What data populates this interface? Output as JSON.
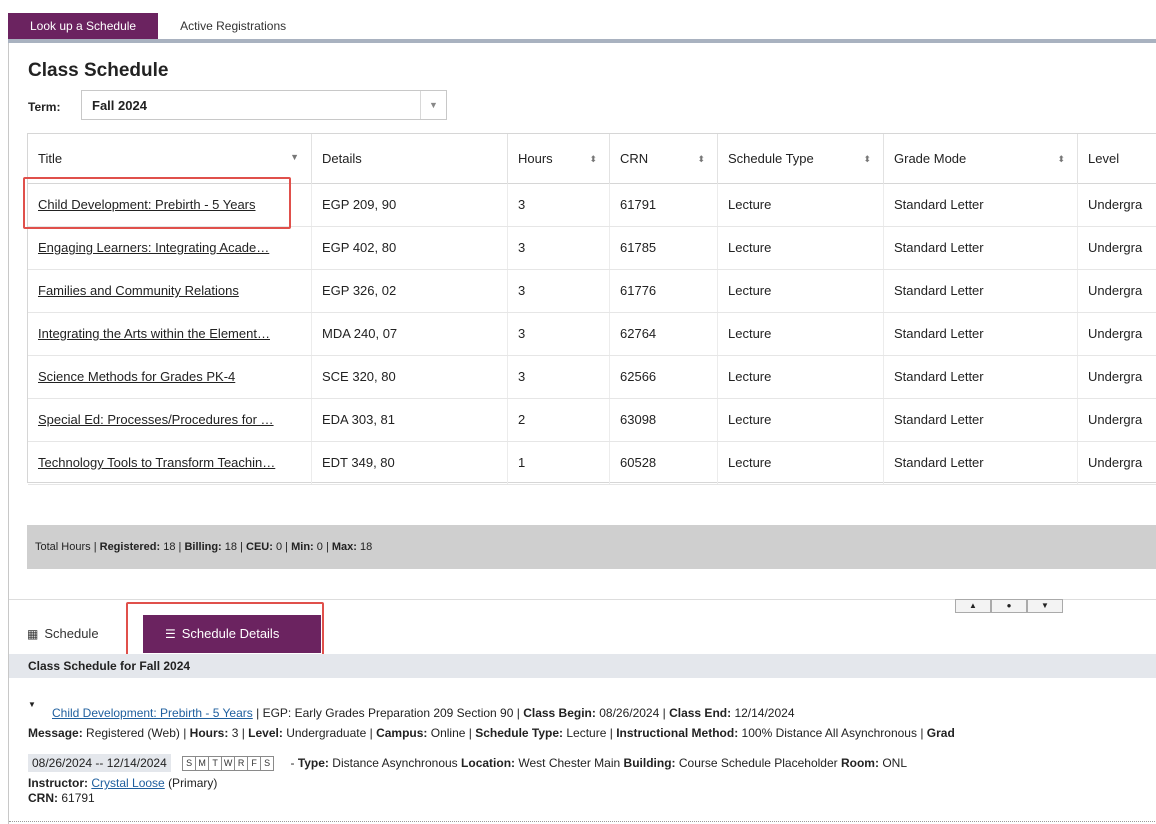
{
  "top_tabs": [
    "Look up a Schedule",
    "Active Registrations"
  ],
  "page_title": "Class Schedule",
  "term": {
    "label": "Term:",
    "value": "Fall 2024"
  },
  "grid": {
    "columns": [
      "Title",
      "Details",
      "Hours",
      "CRN",
      "Schedule Type",
      "Grade Mode",
      "Level"
    ],
    "rows": [
      {
        "title": "Child Development: Prebirth - 5 Years",
        "details": "EGP 209, 90",
        "hours": "3",
        "crn": "61791",
        "type": "Lecture",
        "grade": "Standard Letter",
        "level": "Undergra"
      },
      {
        "title": "Engaging Learners: Integrating Acade…",
        "details": "EGP 402, 80",
        "hours": "3",
        "crn": "61785",
        "type": "Lecture",
        "grade": "Standard Letter",
        "level": "Undergra"
      },
      {
        "title": "Families and Community Relations",
        "details": "EGP 326, 02",
        "hours": "3",
        "crn": "61776",
        "type": "Lecture",
        "grade": "Standard Letter",
        "level": "Undergra"
      },
      {
        "title": "Integrating the Arts within the Element…",
        "details": "MDA 240, 07",
        "hours": "3",
        "crn": "62764",
        "type": "Lecture",
        "grade": "Standard Letter",
        "level": "Undergra"
      },
      {
        "title": "Science Methods for Grades PK-4",
        "details": "SCE 320, 80",
        "hours": "3",
        "crn": "62566",
        "type": "Lecture",
        "grade": "Standard Letter",
        "level": "Undergra"
      },
      {
        "title": "Special Ed: Processes/Procedures for …",
        "details": "EDA 303, 81",
        "hours": "2",
        "crn": "63098",
        "type": "Lecture",
        "grade": "Standard Letter",
        "level": "Undergra"
      },
      {
        "title": "Technology Tools to Transform Teachin…",
        "details": "EDT 349, 80",
        "hours": "1",
        "crn": "60528",
        "type": "Lecture",
        "grade": "Standard Letter",
        "level": "Undergra"
      }
    ]
  },
  "totals": {
    "prefix": "Total Hours |",
    "registered_label": "Registered:",
    "registered": "18",
    "billing_label": "Billing:",
    "billing": "18",
    "ceu_label": "CEU:",
    "ceu": "0",
    "min_label": "Min:",
    "min": "0",
    "max_label": "Max:",
    "max": "18"
  },
  "bottom_tabs": {
    "schedule": "Schedule",
    "details": "Schedule Details"
  },
  "schedule_header": "Class Schedule for Fall 2024",
  "detail": {
    "course_link": "Child Development: Prebirth - 5 Years",
    "subject_text": "EGP: Early Grades Preparation 209 Section 90",
    "class_begin_label": "Class Begin:",
    "class_begin": "08/26/2024",
    "class_end_label": "Class End:",
    "class_end": "12/14/2024",
    "message_label": "Message:",
    "message": "Registered (Web)",
    "hours_label": "Hours:",
    "hours": "3",
    "level_label": "Level:",
    "level": "Undergraduate",
    "campus_label": "Campus:",
    "campus": "Online",
    "schedule_type_label": "Schedule Type:",
    "schedule_type": "Lecture",
    "method_label": "Instructional Method:",
    "method": "100% Distance All Asynchronous",
    "grade_label_partial": "Grad",
    "date_range": "08/26/2024 -- 12/14/2024",
    "days": [
      "S",
      "M",
      "T",
      "W",
      "R",
      "F",
      "S"
    ],
    "type_label": "Type:",
    "type": "Distance Asynchronous",
    "location_label": "Location:",
    "location": "West Chester Main",
    "building_label": "Building:",
    "building": "Course Schedule Placeholder",
    "room_label": "Room:",
    "room": "ONL",
    "instructor_label": "Instructor:",
    "instructor": "Crystal Loose",
    "instructor_role": "(Primary)",
    "crn_label": "CRN:",
    "crn": "61791"
  },
  "colors": {
    "accent": "#6b2360",
    "highlight": "#e0504b",
    "link": "#1f5f9e"
  }
}
